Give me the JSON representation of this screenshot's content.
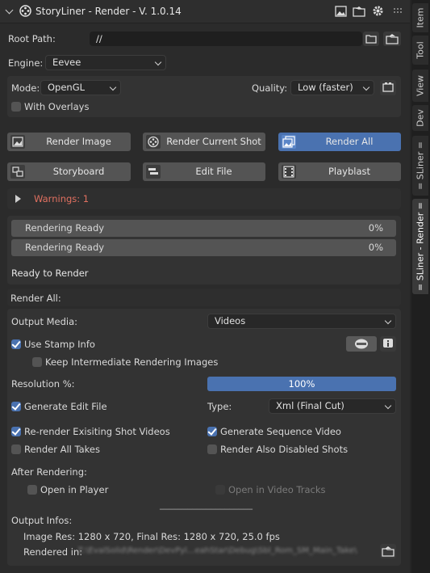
{
  "header": {
    "title": "StoryLiner - Render - V. 1.0.14"
  },
  "root_path": {
    "label": "Root Path:",
    "value": "//"
  },
  "engine": {
    "label": "Engine:",
    "value": "Eevee"
  },
  "settings": {
    "mode_label": "Mode:",
    "mode_value": "OpenGL",
    "quality_label": "Quality:",
    "quality_value": "Low (faster)",
    "with_overlays": "With Overlays"
  },
  "buttons": {
    "render_image": "Render Image",
    "render_current_shot": "Render Current Shot",
    "render_all": "Render All",
    "storyboard": "Storyboard",
    "edit_file": "Edit File",
    "playblast": "Playblast"
  },
  "warnings": {
    "label": "Warnings: 1",
    "color": "#e07060"
  },
  "progress": [
    {
      "label": "Rendering Ready",
      "percent": "0%"
    },
    {
      "label": "Rendering Ready",
      "percent": "0%"
    }
  ],
  "status": "Ready to Render",
  "render_all": {
    "title": "Render All:",
    "output_media_label": "Output Media:",
    "output_media_value": "Videos",
    "use_stamp_info": "Use Stamp Info",
    "keep_intermediate": "Keep Intermediate Rendering Images",
    "resolution_label": "Resolution %:",
    "resolution_value": "100%",
    "generate_edit_file": "Generate Edit File",
    "type_label": "Type:",
    "type_value": "Xml (Final Cut)",
    "rerender_existing": "Re-render Exisiting Shot Videos",
    "generate_sequence": "Generate Sequence Video",
    "render_all_takes": "Render All Takes",
    "render_disabled_shots": "Render Also Disabled Shots",
    "after_rendering": "After Rendering:",
    "open_in_player": "Open in Player",
    "open_in_video_tracks": "Open in Video Tracks",
    "separator": "____________________",
    "output_infos": "Output Infos:",
    "image_res": "Image Res: 1280 x 720,  Final Res: 1280 x 720,  25.0 fps",
    "rendered_in_label": "Rendered in:",
    "rendered_in_value": "Z:\\EvalSolid\\Render\\DevPyl...eahStar\\Debug\\Sbl_Rom_SM_Main_Take\\"
  },
  "tabs": [
    "Item",
    "Tool",
    "View",
    "Dev",
    "= SLiner =",
    "= SLiner - Render ="
  ],
  "colors": {
    "accent": "#4a72b0",
    "panel": "#2b2b2b",
    "button": "#545454"
  }
}
